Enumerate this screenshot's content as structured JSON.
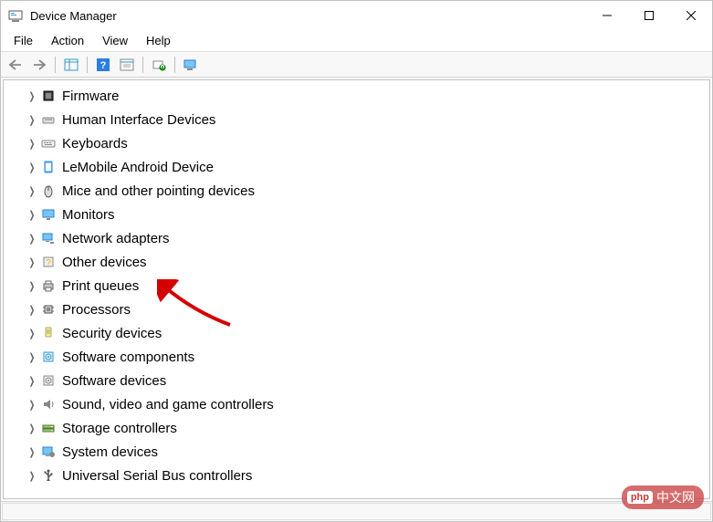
{
  "window": {
    "title": "Device Manager"
  },
  "menu": {
    "file": "File",
    "action": "Action",
    "view": "View",
    "help": "Help"
  },
  "tree": {
    "items": [
      {
        "label": "Firmware",
        "icon": "firmware-icon"
      },
      {
        "label": "Human Interface Devices",
        "icon": "hid-icon"
      },
      {
        "label": "Keyboards",
        "icon": "keyboard-icon"
      },
      {
        "label": "LeMobile Android Device",
        "icon": "android-icon"
      },
      {
        "label": "Mice and other pointing devices",
        "icon": "mouse-icon"
      },
      {
        "label": "Monitors",
        "icon": "monitor-icon"
      },
      {
        "label": "Network adapters",
        "icon": "network-icon"
      },
      {
        "label": "Other devices",
        "icon": "other-icon"
      },
      {
        "label": "Print queues",
        "icon": "printer-icon"
      },
      {
        "label": "Processors",
        "icon": "cpu-icon"
      },
      {
        "label": "Security devices",
        "icon": "security-icon"
      },
      {
        "label": "Software components",
        "icon": "software-comp-icon"
      },
      {
        "label": "Software devices",
        "icon": "software-dev-icon"
      },
      {
        "label": "Sound, video and game controllers",
        "icon": "sound-icon"
      },
      {
        "label": "Storage controllers",
        "icon": "storage-icon"
      },
      {
        "label": "System devices",
        "icon": "system-icon"
      },
      {
        "label": "Universal Serial Bus controllers",
        "icon": "usb-icon"
      }
    ]
  },
  "watermark": {
    "badge": "php",
    "text": "中文网"
  }
}
